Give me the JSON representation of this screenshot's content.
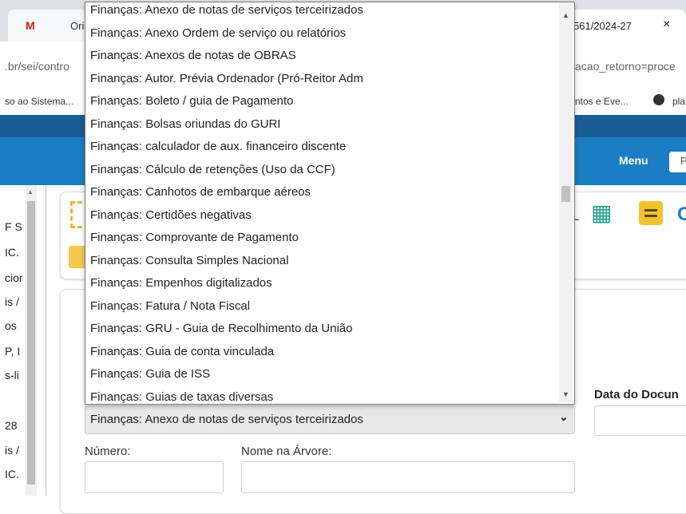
{
  "browser": {
    "tab_left_title": "Orienta",
    "tab_right_title": "561/2024-27",
    "tab_close": "×",
    "url_left": ".br/sei/contro",
    "url_right": "acao_retorno=proce",
    "bookmark_left": "so ao Sistema...",
    "bookmark_right": "ntos e Eve...",
    "bookmark_right2": "pla"
  },
  "header": {
    "menu_label": "Menu",
    "search_partial": "P"
  },
  "sidebar": {
    "fragments": [
      "F S",
      "IC.",
      "cior",
      "is /",
      "os",
      "P, I",
      "s-li",
      "28",
      "is /",
      "IC."
    ]
  },
  "dropdown": {
    "options": [
      "Finanças: Anexo de notas de serviços terceirizados",
      "Finanças: Anexo Ordem de serviço ou relatórios",
      "Finanças: Anexos de notas de OBRAS",
      "Finanças: Autor. Prévia Ordenador (Pró-Reitor Adm",
      "Finanças: Boleto / guia de Pagamento",
      "Finanças: Bolsas oriundas do GURI",
      "Finanças: calculador de aux. financeiro discente",
      "Finanças: Cálculo de retenções (Uso da CCF)",
      "Finanças: Canhotos de embarque aéreos",
      "Finanças: Certidões negativas",
      "Finanças: Comprovante de Pagamento",
      "Finanças: Consulta Simples Nacional",
      "Finanças: Empenhos digitalizados",
      "Finanças: Fatura / Nota Fiscal",
      "Finanças: GRU - Guia de Recolhimento da União",
      "Finanças: Guia de conta vinculada",
      "Finanças: Guia de ISS",
      "Finanças: Guias de taxas diversas"
    ]
  },
  "form": {
    "selected_value": "Finanças: Anexo de notas de serviços terceirizados",
    "data_documento_label": "Data do Docun",
    "numero_label": "Número:",
    "nome_arvore_label": "Nome na Árvore:"
  }
}
